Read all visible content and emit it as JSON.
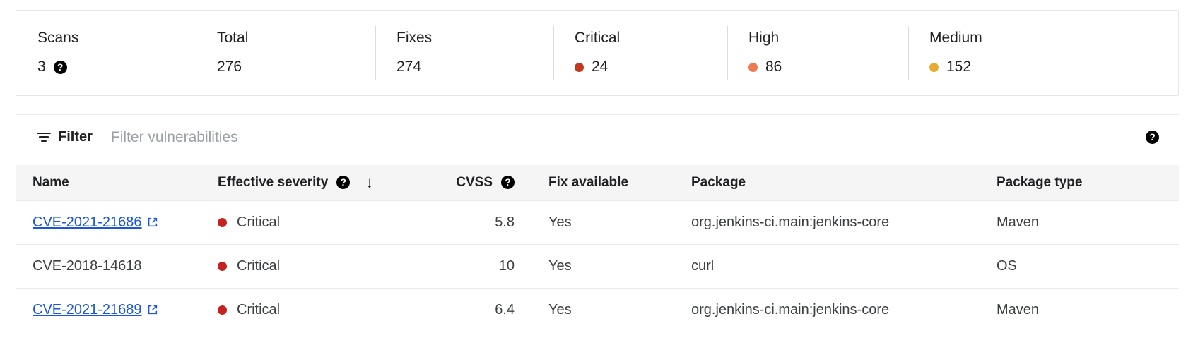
{
  "summary": {
    "stats": [
      {
        "label": "Scans",
        "value": "3",
        "dot_color": null,
        "help": true,
        "help_icon": "help-icon"
      },
      {
        "label": "Total",
        "value": "276",
        "dot_color": null,
        "help": false,
        "help_icon": "help-icon"
      },
      {
        "label": "Fixes",
        "value": "274",
        "dot_color": null,
        "help": false,
        "help_icon": "help-icon"
      },
      {
        "label": "Critical",
        "value": "24",
        "dot_color": "#c5371f",
        "help": false,
        "help_icon": "help-icon"
      },
      {
        "label": "High",
        "value": "86",
        "dot_color": "#ef7a52",
        "help": false,
        "help_icon": "help-icon"
      },
      {
        "label": "Medium",
        "value": "152",
        "dot_color": "#e8ab32",
        "help": false,
        "help_icon": "help-icon"
      }
    ]
  },
  "filter": {
    "icon": "filter-icon",
    "label": "Filter",
    "placeholder": "Filter vulnerabilities",
    "value": "",
    "help_icon": "help-icon"
  },
  "table": {
    "columns": [
      {
        "key": "name",
        "label": "Name",
        "help": false,
        "sort": null,
        "align": "left"
      },
      {
        "key": "severity",
        "label": "Effective severity",
        "help": true,
        "sort": "desc",
        "align": "left"
      },
      {
        "key": "cvss",
        "label": "CVSS",
        "help": true,
        "sort": null,
        "align": "right"
      },
      {
        "key": "fix",
        "label": "Fix available",
        "help": false,
        "sort": null,
        "align": "left"
      },
      {
        "key": "package",
        "label": "Package",
        "help": false,
        "sort": null,
        "align": "left"
      },
      {
        "key": "package_type",
        "label": "Package type",
        "help": false,
        "sort": null,
        "align": "left"
      }
    ],
    "sort_arrow_glyph": "↓",
    "rows": [
      {
        "name": "CVE-2021-21686",
        "is_link": true,
        "external_icon": "external-link-icon",
        "severity": "Critical",
        "severity_color": "#c5221f",
        "cvss": "5.8",
        "fix": "Yes",
        "package": "org.jenkins-ci.main:jenkins-core",
        "package_type": "Maven"
      },
      {
        "name": "CVE-2018-14618",
        "is_link": false,
        "external_icon": null,
        "severity": "Critical",
        "severity_color": "#c5221f",
        "cvss": "10",
        "fix": "Yes",
        "package": "curl",
        "package_type": "OS"
      },
      {
        "name": "CVE-2021-21689",
        "is_link": true,
        "external_icon": "external-link-icon",
        "severity": "Critical",
        "severity_color": "#c5221f",
        "cvss": "6.4",
        "fix": "Yes",
        "package": "org.jenkins-ci.main:jenkins-core",
        "package_type": "Maven"
      }
    ]
  },
  "help_glyph": "?"
}
